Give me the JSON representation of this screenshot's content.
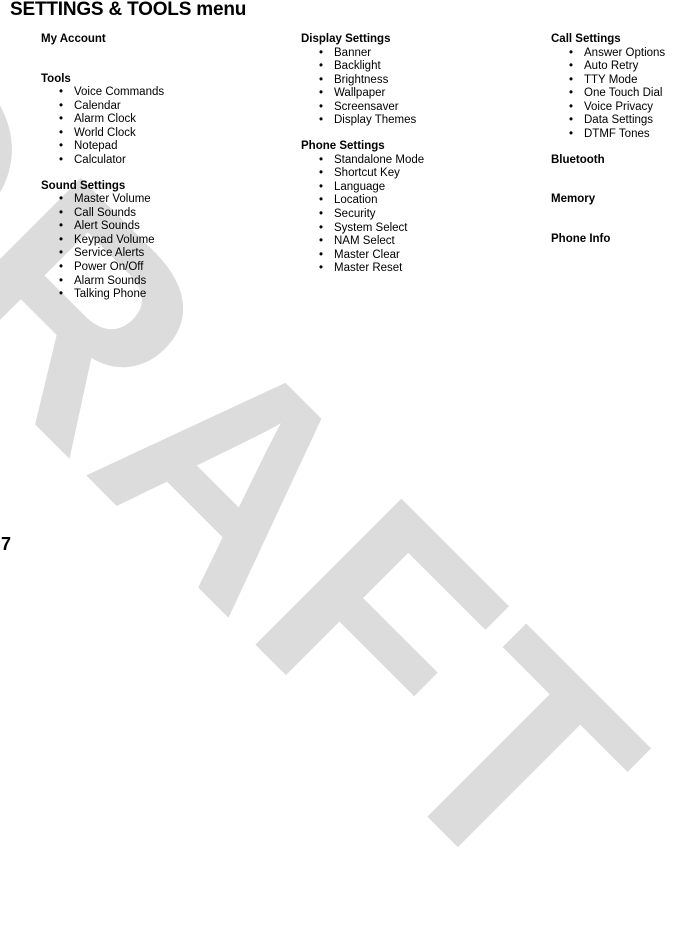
{
  "page": {
    "title_main": "SETTINGS & TOOLS",
    "title_sub": " menu",
    "page_number": "7",
    "watermark": "DRAFT",
    "watermark_color": "#dcdcdc",
    "text_color": "#000000",
    "background_color": "#ffffff",
    "bullet_glyph": "•"
  },
  "columns": [
    {
      "id": "column-1",
      "sections": [
        {
          "header": "My Account",
          "items": []
        },
        {
          "header": "Tools",
          "items": [
            "Voice Commands",
            "Calendar",
            "Alarm Clock",
            "World Clock",
            "Notepad",
            "Calculator"
          ]
        },
        {
          "header": "Sound Settings",
          "items": [
            "Master Volume",
            "Call Sounds",
            "Alert Sounds",
            "Keypad Volume",
            "Service Alerts",
            "Power On/Off",
            "Alarm Sounds",
            "Talking Phone"
          ]
        }
      ]
    },
    {
      "id": "column-2",
      "sections": [
        {
          "header": "Display Settings",
          "items": [
            "Banner",
            "Backlight",
            "Brightness",
            "Wallpaper",
            "Screensaver",
            "Display Themes"
          ]
        },
        {
          "header": "Phone Settings",
          "items": [
            "Standalone Mode",
            "Shortcut Key",
            "Language",
            "Location",
            "Security",
            "System Select",
            "NAM Select",
            "Master Clear",
            "Master Reset"
          ]
        }
      ]
    },
    {
      "id": "column-3",
      "sections": [
        {
          "header": "Call Settings",
          "items": [
            "Answer Options",
            "Auto Retry",
            "TTY Mode",
            "One Touch Dial",
            "Voice Privacy",
            "Data Settings",
            "DTMF Tones"
          ]
        },
        {
          "header": "Bluetooth",
          "items": []
        },
        {
          "header": "Memory",
          "items": []
        },
        {
          "header": "Phone Info",
          "items": []
        }
      ]
    }
  ]
}
